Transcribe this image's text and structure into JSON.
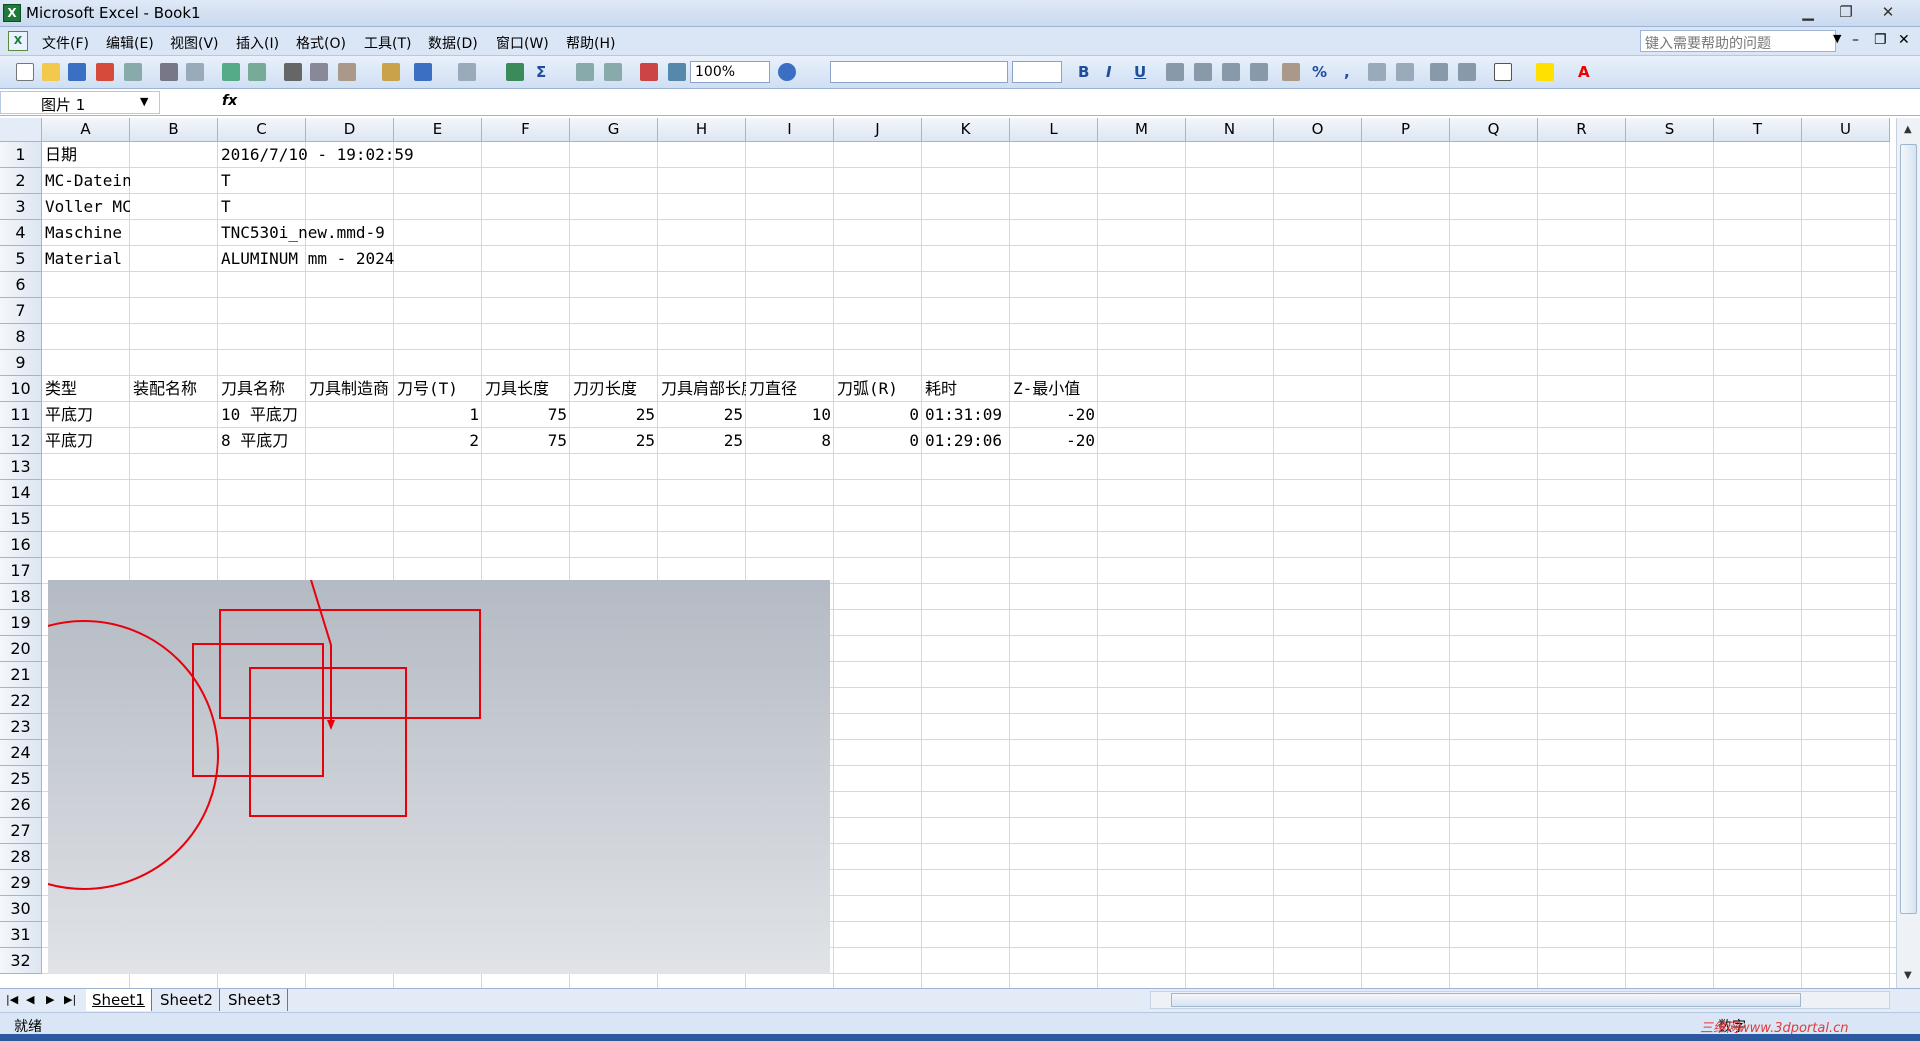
{
  "window": {
    "app_icon": "excel-icon",
    "title": "Microsoft Excel - Book1"
  },
  "menu": {
    "items": [
      "文件(F)",
      "编辑(E)",
      "视图(V)",
      "插入(I)",
      "格式(O)",
      "工具(T)",
      "数据(D)",
      "窗口(W)",
      "帮助(H)"
    ],
    "help_placeholder": "键入需要帮助的问题"
  },
  "toolbar": {
    "zoom": "100%",
    "bold": "B",
    "italic": "I",
    "underline": "U",
    "percent": "%",
    "comma": ","
  },
  "formula_bar": {
    "name_box": "图片 1",
    "fx": "fx"
  },
  "grid": {
    "columns": [
      "A",
      "B",
      "C",
      "D",
      "E",
      "F",
      "G",
      "H",
      "I",
      "J",
      "K",
      "L",
      "M",
      "N",
      "O",
      "P",
      "Q",
      "R",
      "S",
      "T",
      "U"
    ],
    "rows": [
      "1",
      "2",
      "3",
      "4",
      "5",
      "6",
      "7",
      "8",
      "9",
      "10",
      "11",
      "12",
      "13",
      "14",
      "15",
      "16",
      "17",
      "18",
      "19",
      "20",
      "21",
      "22",
      "23",
      "24",
      "25",
      "26",
      "27",
      "28",
      "29",
      "30",
      "31",
      "32"
    ],
    "cells": {
      "A1": "日期",
      "C1": "2016/7/10 - 19:02:59",
      "A2": "MC-Dateiname",
      "C2": "T",
      "A3": "Voller MC-Dateiname",
      "C3": "T",
      "A4": "Maschine",
      "C4": "TNC530i_new.mmd-9",
      "A5": "Material",
      "C5": "ALUMINUM mm - 2024",
      "A10": "类型",
      "B10": "装配名称",
      "C10": "刀具名称",
      "D10": "刀具制造商",
      "E10": "刀号(T)",
      "F10": "刀具长度",
      "G10": "刀刃长度",
      "H10": "刀具肩部长度",
      "I10": "刀直径",
      "J10": "刀弧(R)",
      "K10": "耗时",
      "L10": "Z-最小值",
      "A11": "平底刀",
      "C11": "10 平底刀",
      "E11": "1",
      "F11": "75",
      "G11": "25",
      "H11": "25",
      "I11": "10",
      "J11": "0",
      "K11": "01:31:09",
      "L11": "-20",
      "A12": "平底刀",
      "C12": "8 平底刀",
      "E12": "2",
      "F12": "75",
      "G12": "25",
      "H12": "25",
      "I12": "8",
      "J12": "0",
      "K12": "01:29:06",
      "L12": "-20"
    }
  },
  "sheets": [
    "Sheet1",
    "Sheet2",
    "Sheet3"
  ],
  "status": {
    "text": "就绪",
    "mode": "数字",
    "watermark": "三维网www.3dportal.cn"
  },
  "colors": {
    "accent_red": "#e8000b",
    "picture_top": "#b4bac3",
    "picture_bottom": "#e0e3e7"
  }
}
